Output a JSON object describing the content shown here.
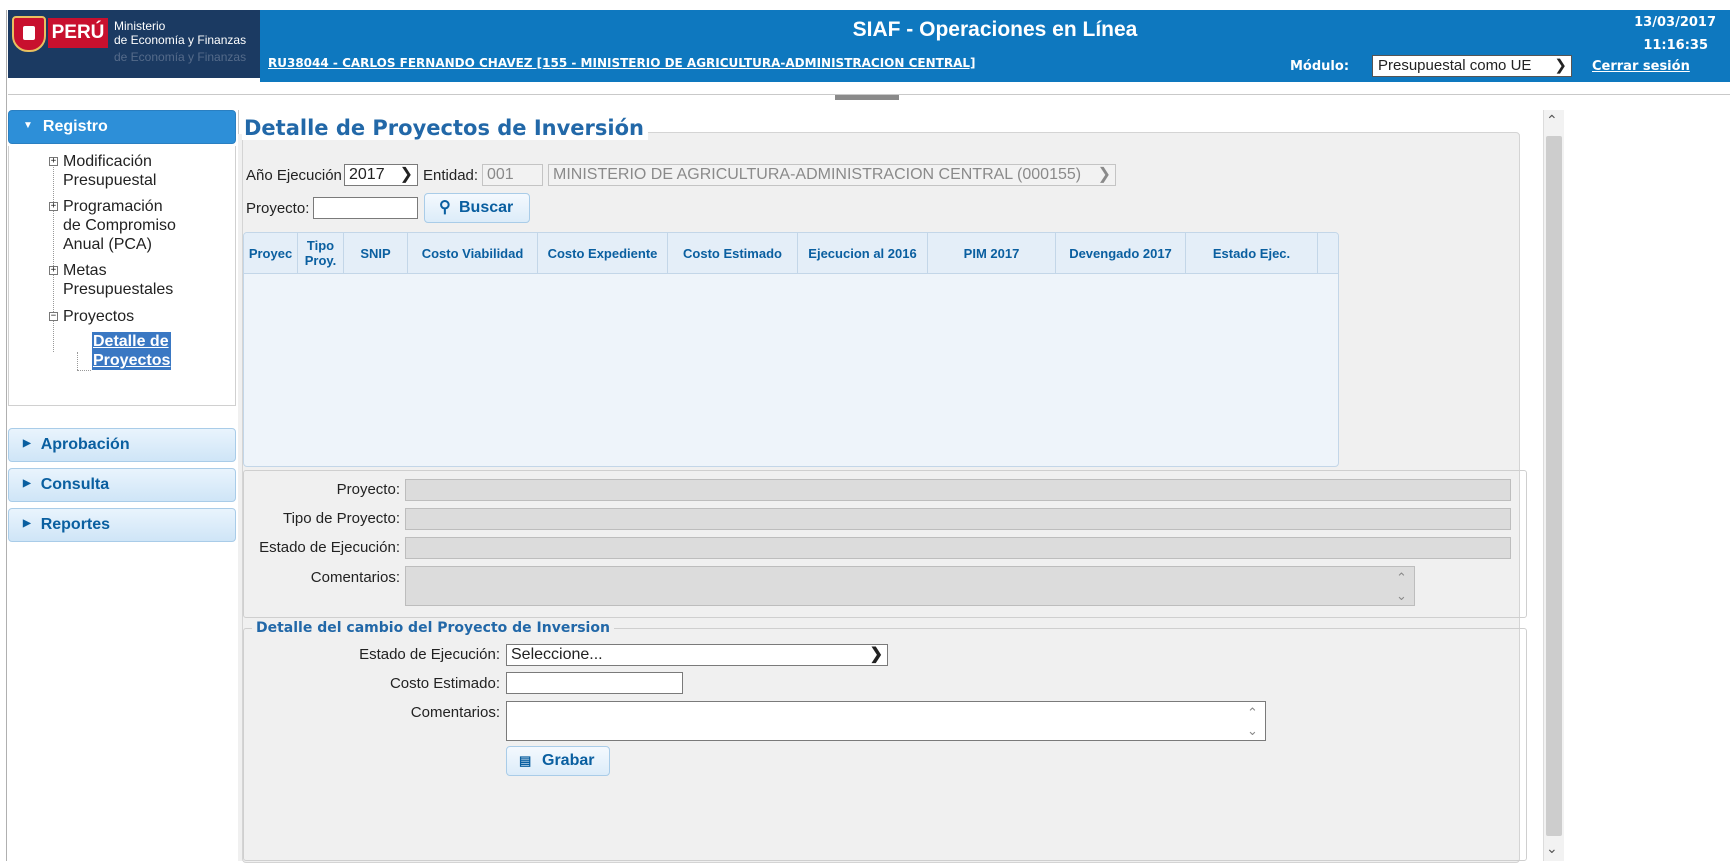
{
  "header": {
    "logo": {
      "peru": "PERÚ",
      "ministry_line1": "Ministerio",
      "ministry_line2": "de Economía y Finanzas",
      "ministry_sub": "de Economía y Finanzas"
    },
    "app_title": "SIAF - Operaciones en Línea",
    "user_link": "RU38044  - CARLOS FERNANDO CHAVEZ [155 - MINISTERIO DE AGRICULTURA-ADMINISTRACION CENTRAL]",
    "date": "13/03/2017",
    "time": "11:16:35",
    "modulo_label": "Módulo:",
    "modulo_value": "Presupuestal como UE",
    "logout": "Cerrar sesión"
  },
  "sidebar": {
    "sections": [
      "Registro",
      "Aprobación",
      "Consulta",
      "Reportes"
    ],
    "tree": [
      {
        "label_l1": "Modificación",
        "label_l2": "Presupuestal",
        "expander": "+"
      },
      {
        "label_l1": "Programación",
        "label_l2": "de Compromiso",
        "label_l3": "Anual (PCA)",
        "expander": "+"
      },
      {
        "label_l1": "Metas",
        "label_l2": "Presupuestales",
        "expander": "+"
      },
      {
        "label_l1": "Proyectos",
        "expander": "−"
      },
      {
        "label_l1": "Detalle de",
        "label_l2": "Proyectos",
        "selected": true
      }
    ]
  },
  "main": {
    "title": "Detalle de Proyectos de Inversión",
    "filters": {
      "anio_label": "Año Ejecución",
      "anio_value": "2017",
      "entidad_label": "Entidad:",
      "entidad_code": "001",
      "entidad_name": "MINISTERIO DE AGRICULTURA-ADMINISTRACION CENTRAL (000155)",
      "proyecto_label": "Proyecto:",
      "proyecto_value": "",
      "search_button": "Buscar"
    },
    "grid": {
      "columns": [
        "Proyec",
        "Tipo Proy.",
        "SNIP",
        "Costo Viabilidad",
        "Costo Expediente",
        "Costo Estimado",
        "Ejecucion al 2016",
        "PIM 2017",
        "Devengado 2017",
        "Estado Ejec."
      ],
      "rows": []
    },
    "details": {
      "proyecto_label": "Proyecto:",
      "tipo_label": "Tipo de Proyecto:",
      "estado_label": "Estado de Ejecución:",
      "comentarios_label": "Comentarios:"
    },
    "cambio": {
      "legend": "Detalle del cambio del Proyecto de Inversion",
      "estado_label": "Estado de Ejecución:",
      "estado_value": "Seleccione...",
      "costo_label": "Costo Estimado:",
      "costo_value": "",
      "comentarios_label": "Comentarios:",
      "comentarios_value": "",
      "save_button": "Grabar"
    }
  },
  "colors": {
    "header_blue": "#0e78bf",
    "accent_blue": "#2268a8",
    "active_tab": "#2d8fd8",
    "logo_red": "#c8102e"
  }
}
